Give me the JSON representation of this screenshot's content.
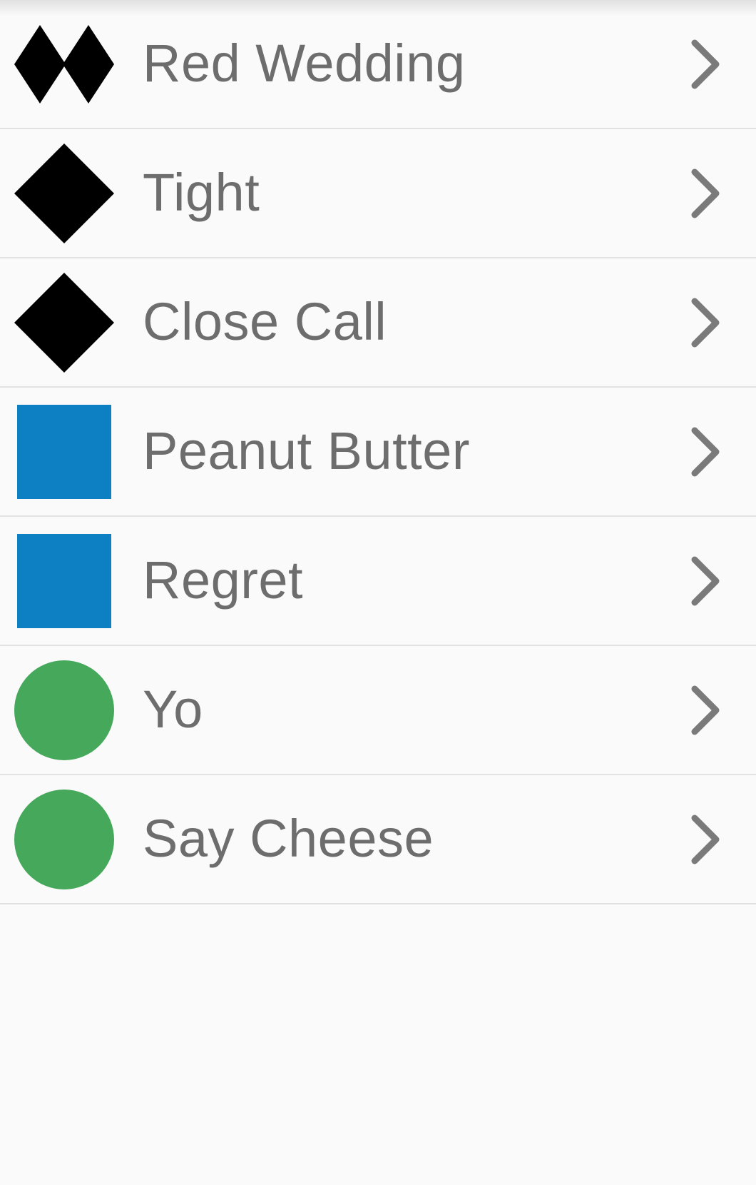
{
  "list": {
    "items": [
      {
        "label": "Red Wedding",
        "icon": "double-black-diamond-icon",
        "color": "#000000"
      },
      {
        "label": "Tight",
        "icon": "black-diamond-icon",
        "color": "#000000"
      },
      {
        "label": "Close Call",
        "icon": "black-diamond-icon",
        "color": "#000000"
      },
      {
        "label": "Peanut Butter",
        "icon": "blue-square-icon",
        "color": "#0d80c4"
      },
      {
        "label": "Regret",
        "icon": "blue-square-icon",
        "color": "#0d80c4"
      },
      {
        "label": "Yo",
        "icon": "green-circle-icon",
        "color": "#45a85a"
      },
      {
        "label": "Say Cheese",
        "icon": "green-circle-icon",
        "color": "#45a85a"
      }
    ],
    "chevron_icon": "chevron-right-icon",
    "chevron_color": "#7a7a7a",
    "label_color": "#6d6d6d",
    "divider_color": "#e2e2e2",
    "background_color": "#fafafa"
  }
}
